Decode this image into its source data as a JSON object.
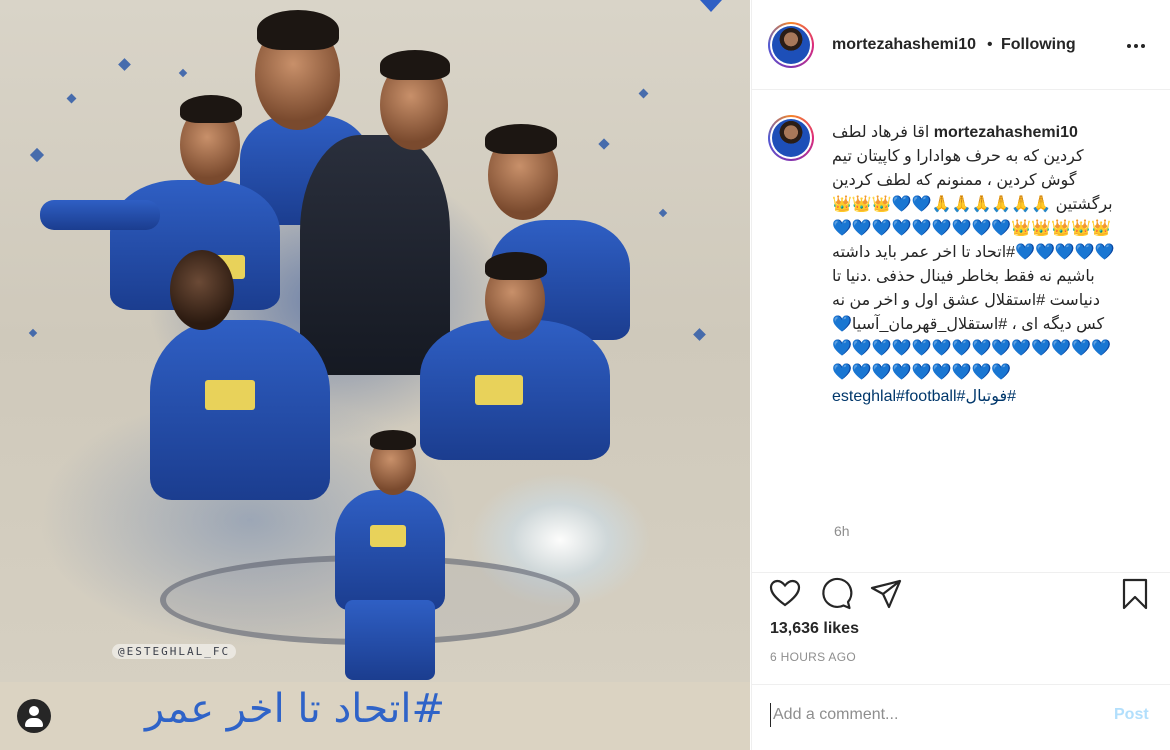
{
  "post": {
    "username": "mortezahashemi10",
    "follow_separator": "•",
    "follow_status": "Following",
    "caption": "اقا فرهاد لطف کردین که به حرف هوادارا و کاپیتان تیم گوش کردین ، ممنونم که لطف کردین برگشتین 🙏🙏🙏🙏🙏🙏💙💙👑👑👑👑👑👑👑👑💙💙💙💙💙💙💙💙💙💙💙💙💙💙#اتحاد تا اخر عمر باید داشته باشیم نه فقط بخاطر فینال حذفی .دنیا تا دنیاست #استقلال عشق اول و اخر من نه کس دیگه ای ، #استقلال_قهرمان_آسیا💙💙💙💙💙💙💙💙💙💙💙💙💙💙💙💙💙💙💙💙💙💙💙💙",
    "caption_tags": "#فوتبال#esteghlal#football",
    "time_ago": "6h",
    "likes": "13,636 likes",
    "posted": "6 HOURS AGO"
  },
  "comment": {
    "placeholder": "Add a comment...",
    "post_label": "Post"
  },
  "image": {
    "watermark": "@ESTEGHLAL_FC",
    "hashtag_banner": "#اتحاد تا اخر عمر"
  },
  "colors": {
    "link": "#00376b",
    "post_button_disabled": "#b2dffc",
    "secondary_text": "#8e8e8e",
    "club_blue": "#1d4fb8"
  },
  "icons": {
    "more": "more-options-icon",
    "like": "heart-icon",
    "comment": "comment-icon",
    "share": "send-icon",
    "save": "bookmark-icon",
    "tag": "user-tag-icon"
  }
}
